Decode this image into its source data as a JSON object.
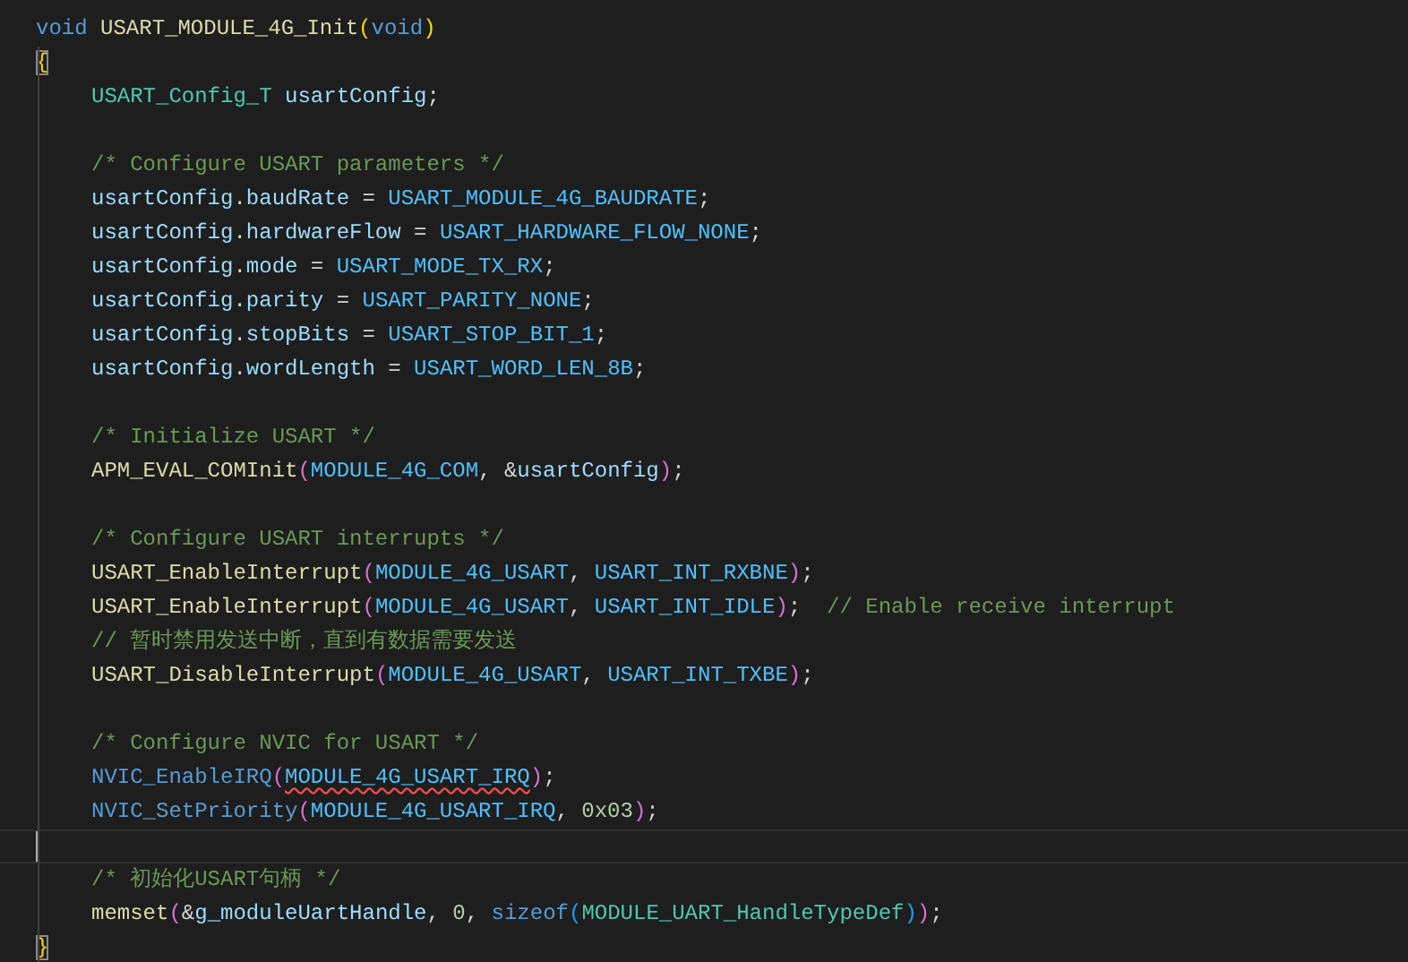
{
  "editor": {
    "lines": [
      {
        "tokens": [
          {
            "text": "void ",
            "kind": "kw"
          },
          {
            "text": "USART_MODULE_4G_Init",
            "kind": "fn"
          },
          {
            "text": "(",
            "kind": "b1"
          },
          {
            "text": "void",
            "kind": "kw"
          },
          {
            "text": ")",
            "kind": "b1"
          }
        ]
      },
      {
        "tokens": [
          {
            "text": "{",
            "kind": "b1",
            "matched": true
          }
        ]
      },
      {
        "indented": true,
        "tokens": [
          {
            "text": "USART_Config_T ",
            "kind": "type"
          },
          {
            "text": "usartConfig",
            "kind": "var"
          },
          {
            "text": ";",
            "kind": "p"
          }
        ]
      },
      {
        "indented": true,
        "blank_before": true,
        "tokens": [
          {
            "text": "/* Configure USART parameters */",
            "kind": "cmt"
          }
        ]
      },
      {
        "indented": true,
        "tokens": [
          {
            "text": "usartConfig",
            "kind": "var"
          },
          {
            "text": ".",
            "kind": "p"
          },
          {
            "text": "baudRate",
            "kind": "var"
          },
          {
            "text": " = ",
            "kind": "p"
          },
          {
            "text": "USART_MODULE_4G_BAUDRATE",
            "kind": "macro"
          },
          {
            "text": ";",
            "kind": "p"
          }
        ]
      },
      {
        "indented": true,
        "tokens": [
          {
            "text": "usartConfig",
            "kind": "var"
          },
          {
            "text": ".",
            "kind": "p"
          },
          {
            "text": "hardwareFlow",
            "kind": "var"
          },
          {
            "text": " = ",
            "kind": "p"
          },
          {
            "text": "USART_HARDWARE_FLOW_NONE",
            "kind": "macro"
          },
          {
            "text": ";",
            "kind": "p"
          }
        ]
      },
      {
        "indented": true,
        "tokens": [
          {
            "text": "usartConfig",
            "kind": "var"
          },
          {
            "text": ".",
            "kind": "p"
          },
          {
            "text": "mode",
            "kind": "var"
          },
          {
            "text": " = ",
            "kind": "p"
          },
          {
            "text": "USART_MODE_TX_RX",
            "kind": "macro"
          },
          {
            "text": ";",
            "kind": "p"
          }
        ]
      },
      {
        "indented": true,
        "tokens": [
          {
            "text": "usartConfig",
            "kind": "var"
          },
          {
            "text": ".",
            "kind": "p"
          },
          {
            "text": "parity",
            "kind": "var"
          },
          {
            "text": " = ",
            "kind": "p"
          },
          {
            "text": "USART_PARITY_NONE",
            "kind": "macro"
          },
          {
            "text": ";",
            "kind": "p"
          }
        ]
      },
      {
        "indented": true,
        "tokens": [
          {
            "text": "usartConfig",
            "kind": "var"
          },
          {
            "text": ".",
            "kind": "p"
          },
          {
            "text": "stopBits",
            "kind": "var"
          },
          {
            "text": " = ",
            "kind": "p"
          },
          {
            "text": "USART_STOP_BIT_1",
            "kind": "macro"
          },
          {
            "text": ";",
            "kind": "p"
          }
        ]
      },
      {
        "indented": true,
        "tokens": [
          {
            "text": "usartConfig",
            "kind": "var"
          },
          {
            "text": ".",
            "kind": "p"
          },
          {
            "text": "wordLength",
            "kind": "var"
          },
          {
            "text": " = ",
            "kind": "p"
          },
          {
            "text": "USART_WORD_LEN_8B",
            "kind": "macro"
          },
          {
            "text": ";",
            "kind": "p"
          }
        ]
      },
      {
        "indented": true,
        "blank_before": true,
        "tokens": [
          {
            "text": "/* Initialize USART */",
            "kind": "cmt"
          }
        ]
      },
      {
        "indented": true,
        "tokens": [
          {
            "text": "APM_EVAL_COMInit",
            "kind": "fn"
          },
          {
            "text": "(",
            "kind": "b2"
          },
          {
            "text": "MODULE_4G_COM",
            "kind": "macro"
          },
          {
            "text": ", &",
            "kind": "p"
          },
          {
            "text": "usartConfig",
            "kind": "var"
          },
          {
            "text": ")",
            "kind": "b2"
          },
          {
            "text": ";",
            "kind": "p"
          }
        ]
      },
      {
        "indented": true,
        "blank_before": true,
        "tokens": [
          {
            "text": "/* Configure USART interrupts */",
            "kind": "cmt"
          }
        ]
      },
      {
        "indented": true,
        "tokens": [
          {
            "text": "USART_EnableInterrupt",
            "kind": "fn"
          },
          {
            "text": "(",
            "kind": "b2"
          },
          {
            "text": "MODULE_4G_USART",
            "kind": "macro"
          },
          {
            "text": ", ",
            "kind": "p"
          },
          {
            "text": "USART_INT_RXBNE",
            "kind": "macro"
          },
          {
            "text": ")",
            "kind": "b2"
          },
          {
            "text": ";",
            "kind": "p"
          }
        ]
      },
      {
        "indented": true,
        "tokens": [
          {
            "text": "USART_EnableInterrupt",
            "kind": "fn"
          },
          {
            "text": "(",
            "kind": "b2"
          },
          {
            "text": "MODULE_4G_USART",
            "kind": "macro"
          },
          {
            "text": ", ",
            "kind": "p"
          },
          {
            "text": "USART_INT_IDLE",
            "kind": "macro"
          },
          {
            "text": ")",
            "kind": "b2"
          },
          {
            "text": ";  ",
            "kind": "p"
          },
          {
            "text": "// Enable receive interrupt",
            "kind": "cmt"
          }
        ]
      },
      {
        "indented": true,
        "tokens": [
          {
            "text": "// 暂时禁用发送中断，直到有数据需要发送",
            "kind": "cmt"
          }
        ]
      },
      {
        "indented": true,
        "tokens": [
          {
            "text": "USART_DisableInterrupt",
            "kind": "fn"
          },
          {
            "text": "(",
            "kind": "b2"
          },
          {
            "text": "MODULE_4G_USART",
            "kind": "macro"
          },
          {
            "text": ", ",
            "kind": "p"
          },
          {
            "text": "USART_INT_TXBE",
            "kind": "macro"
          },
          {
            "text": ")",
            "kind": "b2"
          },
          {
            "text": ";",
            "kind": "p"
          }
        ]
      },
      {
        "indented": true,
        "blank_before": true,
        "tokens": [
          {
            "text": "/* Configure NVIC for USART */",
            "kind": "cmt"
          }
        ]
      },
      {
        "indented": true,
        "tokens": [
          {
            "text": "NVIC_EnableIRQ",
            "kind": "kwfn"
          },
          {
            "text": "(",
            "kind": "b2"
          },
          {
            "text": "MODULE_4G_USART_IRQ",
            "kind": "macro",
            "error": true
          },
          {
            "text": ")",
            "kind": "b2"
          },
          {
            "text": ";",
            "kind": "p"
          }
        ]
      },
      {
        "indented": true,
        "tokens": [
          {
            "text": "NVIC_SetPriority",
            "kind": "kwfn"
          },
          {
            "text": "(",
            "kind": "b2"
          },
          {
            "text": "MODULE_4G_USART_IRQ",
            "kind": "macro"
          },
          {
            "text": ", ",
            "kind": "p"
          },
          {
            "text": "0x03",
            "kind": "num"
          },
          {
            "text": ")",
            "kind": "b2"
          },
          {
            "text": ";",
            "kind": "p"
          }
        ]
      },
      {
        "current": true
      },
      {
        "indented": true,
        "tokens": [
          {
            "text": "/* 初始化USART句柄 */",
            "kind": "cmt"
          }
        ]
      },
      {
        "indented": true,
        "tokens": [
          {
            "text": "memset",
            "kind": "fn"
          },
          {
            "text": "(",
            "kind": "b2"
          },
          {
            "text": "&",
            "kind": "p"
          },
          {
            "text": "g_moduleUartHandle",
            "kind": "var"
          },
          {
            "text": ", ",
            "kind": "p"
          },
          {
            "text": "0",
            "kind": "num"
          },
          {
            "text": ", ",
            "kind": "p"
          },
          {
            "text": "sizeof",
            "kind": "kw"
          },
          {
            "text": "(",
            "kind": "b3"
          },
          {
            "text": "MODULE_UART_HandleTypeDef",
            "kind": "type"
          },
          {
            "text": ")",
            "kind": "b3"
          },
          {
            "text": ")",
            "kind": "b2"
          },
          {
            "text": ";",
            "kind": "p"
          }
        ]
      },
      {
        "tokens": [
          {
            "text": "}",
            "kind": "b1",
            "matched": true
          }
        ]
      }
    ]
  }
}
